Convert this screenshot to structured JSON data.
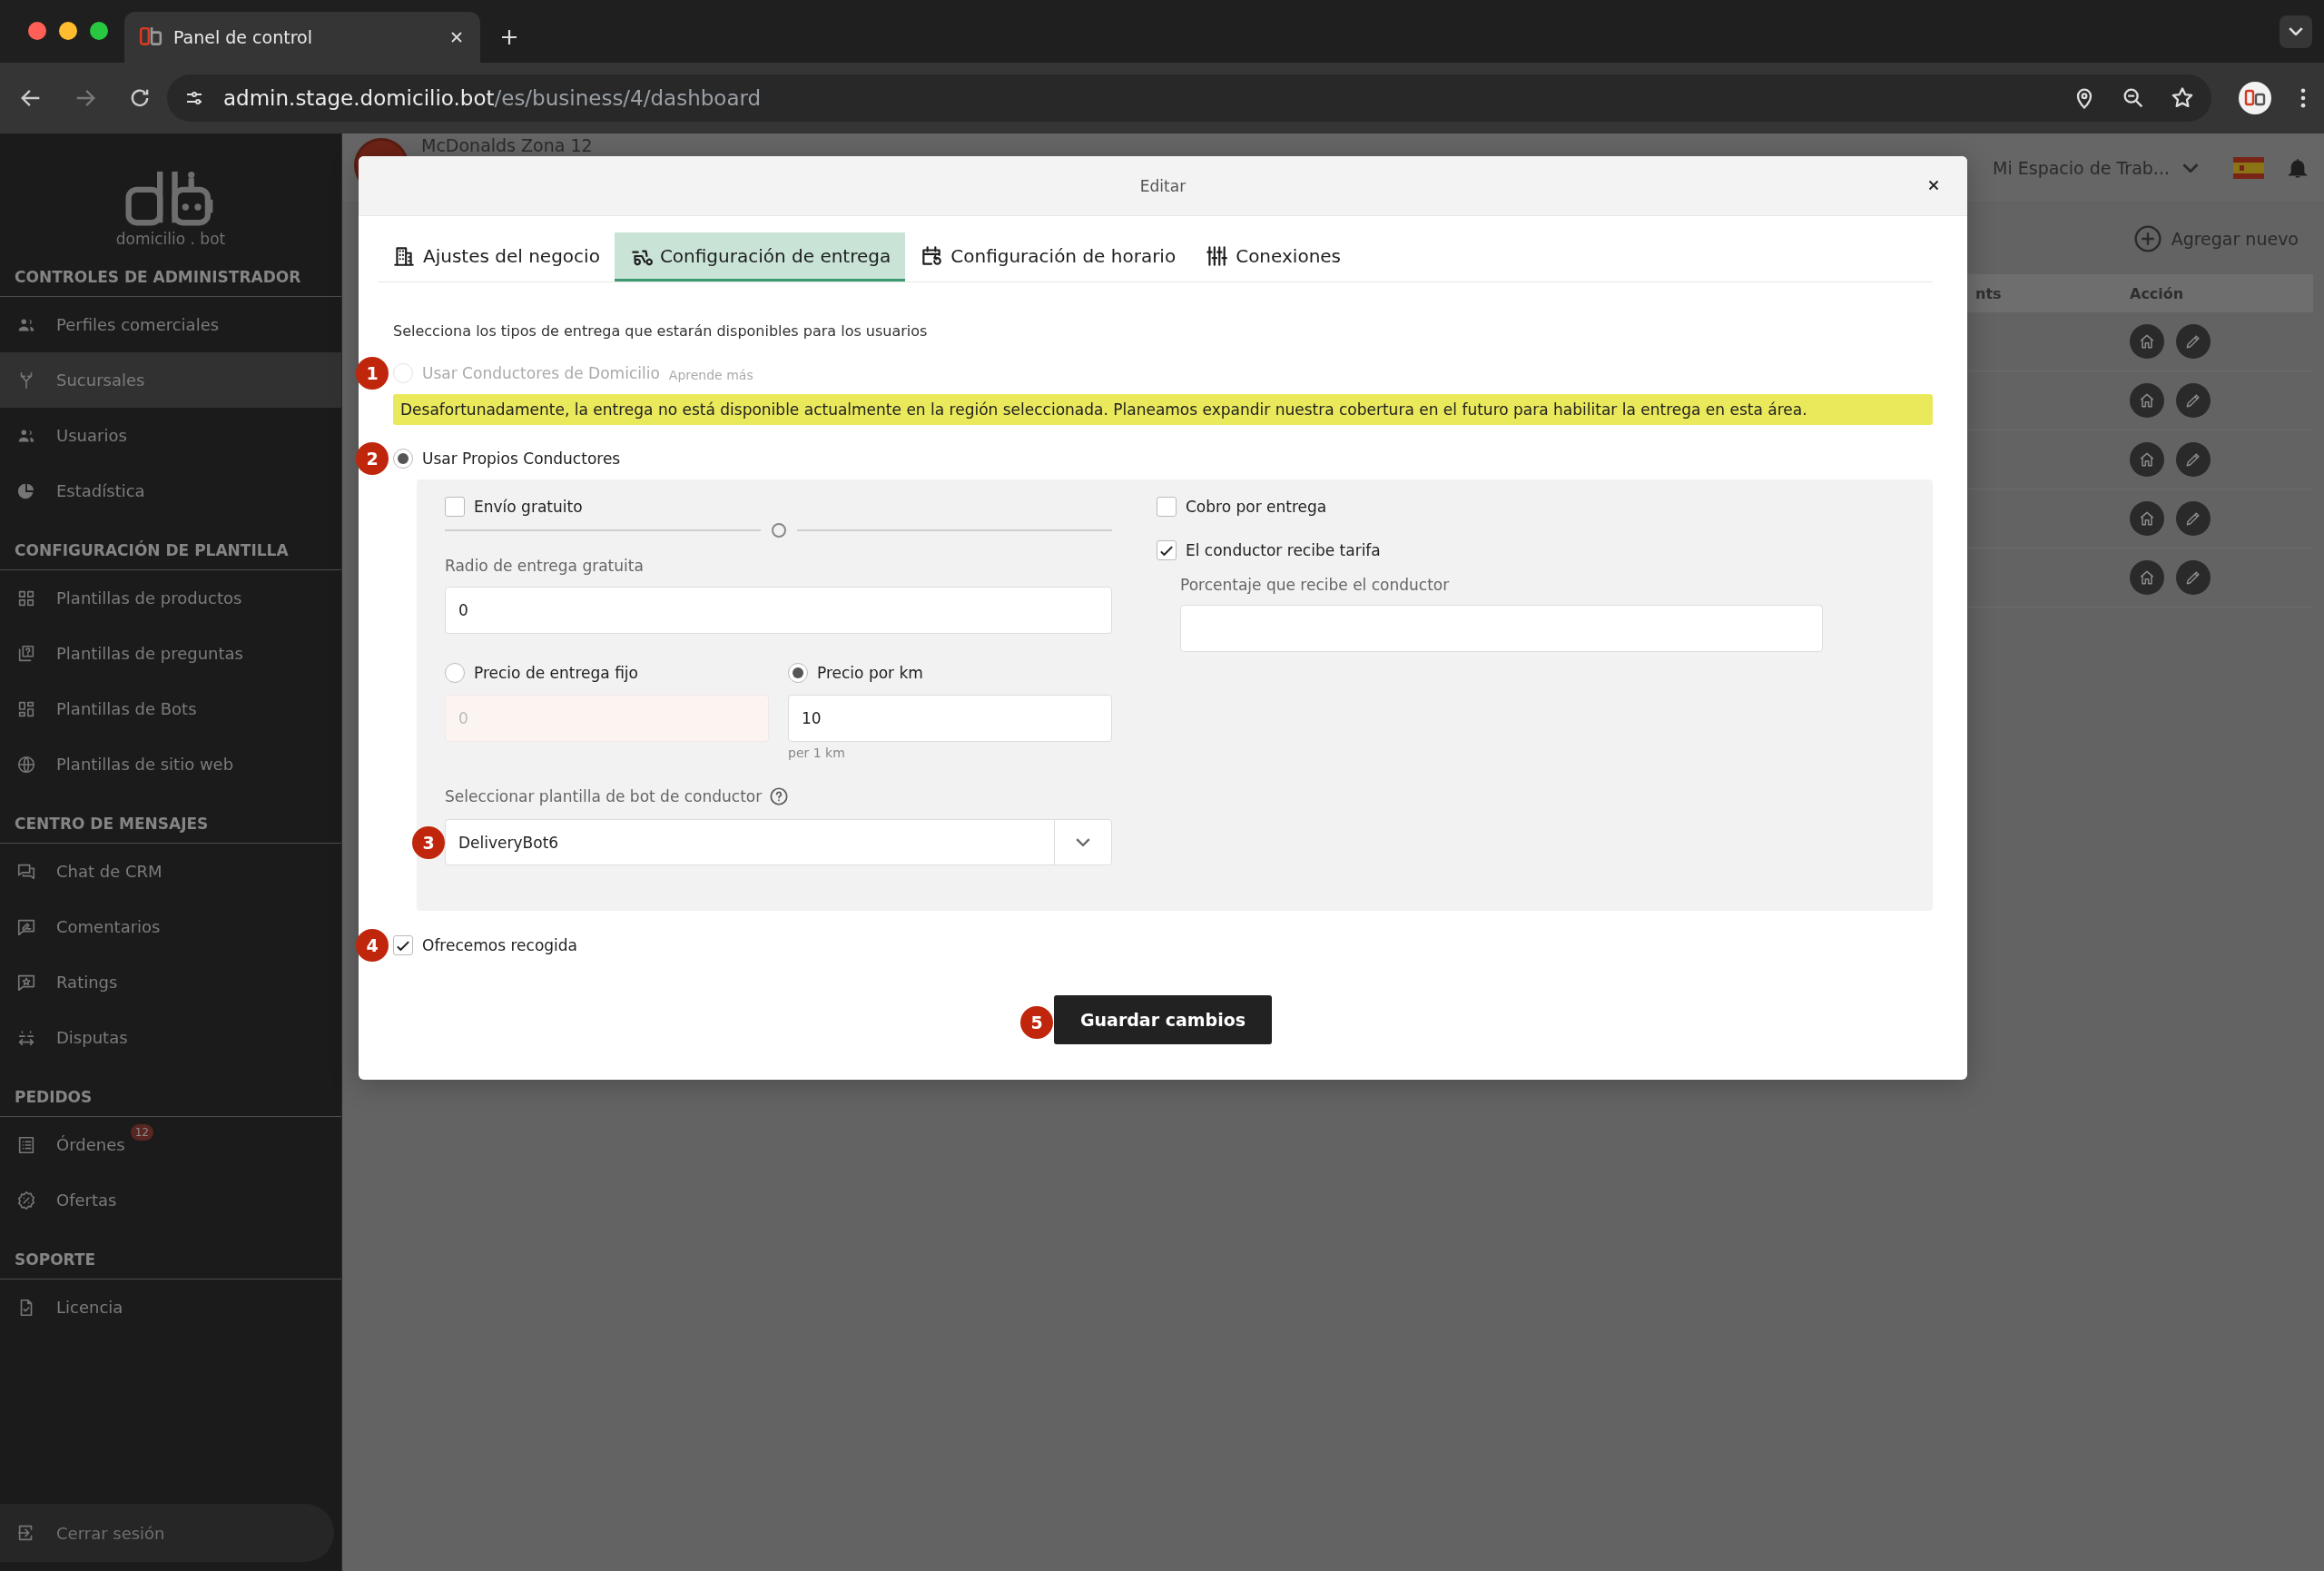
{
  "browser": {
    "tab_title": "Panel de control",
    "url_host": "admin.stage.domicilio.bot",
    "url_path": "/es/business/4/dashboard"
  },
  "sidebar": {
    "logo_text": "domicilio . bot",
    "sections": [
      {
        "title": "CONTROLES DE ADMINISTRADOR",
        "items": [
          {
            "label": "Perfiles comerciales",
            "selected": false
          },
          {
            "label": "Sucursales",
            "selected": true
          },
          {
            "label": "Usuarios",
            "selected": false
          },
          {
            "label": "Estadística",
            "selected": false
          }
        ]
      },
      {
        "title": "CONFIGURACIÓN DE PLANTILLA",
        "items": [
          {
            "label": "Plantillas de productos",
            "selected": false
          },
          {
            "label": "Plantillas de preguntas",
            "selected": false
          },
          {
            "label": "Plantillas de Bots",
            "selected": false
          },
          {
            "label": "Plantillas de sitio web",
            "selected": false
          }
        ]
      },
      {
        "title": "CENTRO DE MENSAJES",
        "items": [
          {
            "label": "Chat de CRM",
            "selected": false
          },
          {
            "label": "Comentarios",
            "selected": false
          },
          {
            "label": "Ratings",
            "selected": false
          },
          {
            "label": "Disputas",
            "selected": false
          }
        ]
      },
      {
        "title": "PEDIDOS",
        "items": [
          {
            "label": "Órdenes",
            "badge": "12",
            "selected": false
          },
          {
            "label": "Ofertas",
            "selected": false
          }
        ]
      },
      {
        "title": "SOPORTE",
        "items": [
          {
            "label": "Licencia",
            "selected": false
          }
        ]
      }
    ],
    "logout": "Cerrar sesión"
  },
  "header": {
    "business_name": "McDonalds Zona 12",
    "workspace": "Mi Espacio de Trab..."
  },
  "content": {
    "add_button": "Agregar nuevo",
    "table": {
      "columns": [
        "nts",
        "Acción"
      ]
    }
  },
  "modal": {
    "title": "Editar",
    "tabs": [
      {
        "label": "Ajustes del negocio",
        "selected": false
      },
      {
        "label": "Configuración de entrega",
        "selected": true
      },
      {
        "label": "Configuración de horario",
        "selected": false
      },
      {
        "label": "Conexiones",
        "selected": false
      }
    ],
    "intro": "Selecciona los tipos de entrega que estarán disponibles para los usuarios",
    "delivery_options": [
      {
        "label": "Usar Conductores de Domicilio",
        "link": "Aprende más",
        "selected": false,
        "disabled": true,
        "warning": "Desafortunadamente, la entrega no está disponible actualmente en la región seleccionada. Planeamos expandir nuestra cobertura en el futuro para habilitar la entrega en esta área."
      },
      {
        "label": "Usar Propios Conductores",
        "selected": true,
        "disabled": false
      }
    ],
    "own_drivers": {
      "free_shipping": {
        "label": "Envío gratuito",
        "checked": false
      },
      "radius_slider": {
        "level": 0.5
      },
      "free_radius": {
        "label": "Radio de entrega gratuita",
        "value": "0"
      },
      "pricing": [
        {
          "label": "Precio de entrega fijo",
          "selected": false,
          "placeholder": "0"
        },
        {
          "label": "Precio por km",
          "selected": true,
          "value": "10",
          "hint": "per 1 km"
        }
      ],
      "bot_template": {
        "label": "Seleccionar plantilla de bot de conductor",
        "value": "DeliveryBot6"
      },
      "cash_on_delivery": {
        "label": "Cobro por entrega",
        "checked": false
      },
      "driver_fee": {
        "label": "El conductor recibe tarifa",
        "checked": true
      },
      "driver_percentage": {
        "label": "Porcentaje que recibe el conductor"
      }
    },
    "pickup": {
      "label": "Ofrecemos recogida",
      "checked": true
    },
    "save_button": "Guardar cambios"
  },
  "markers": [
    "1",
    "2",
    "3",
    "4",
    "5"
  ]
}
